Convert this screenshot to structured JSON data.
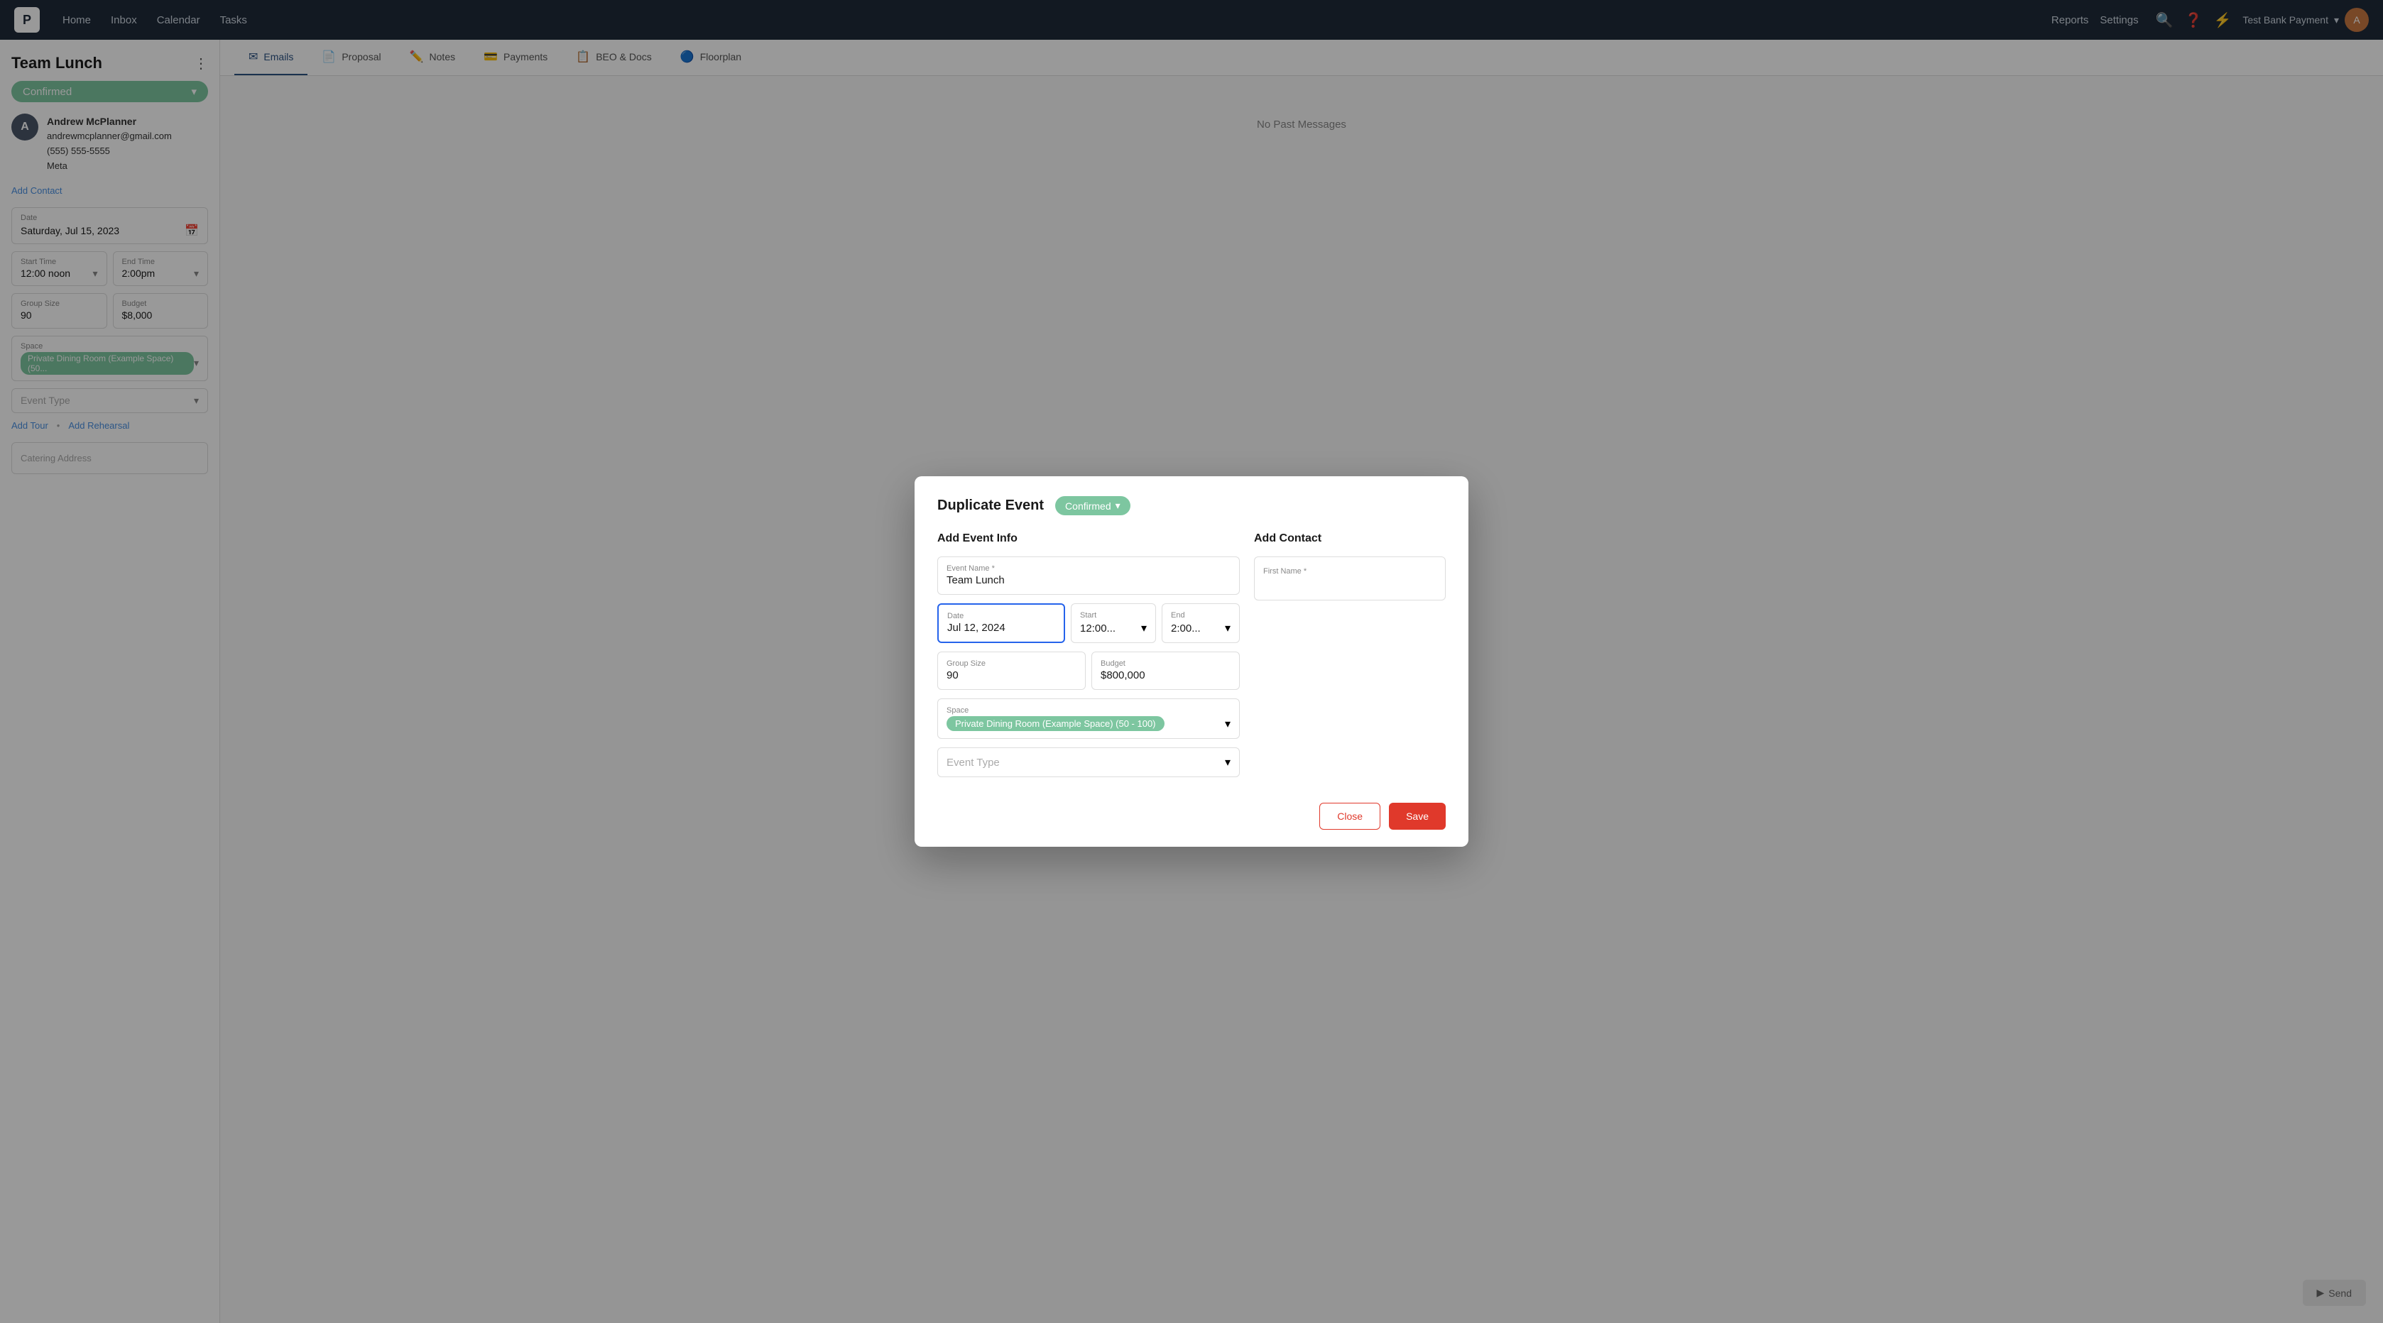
{
  "nav": {
    "logo": "P",
    "links": [
      "Home",
      "Inbox",
      "Calendar",
      "Tasks"
    ],
    "right_links": [
      "Reports",
      "Settings"
    ],
    "account_name": "Test Bank Payment",
    "icons": [
      "search",
      "help",
      "lightning"
    ]
  },
  "sidebar": {
    "title": "Team Lunch",
    "status": "Confirmed",
    "contact": {
      "initial": "A",
      "name": "Andrew McPlanner",
      "email": "andrewmcplanner@gmail.com",
      "phone": "(555) 555-5555",
      "company": "Meta"
    },
    "add_contact": "Add Contact",
    "date_label": "Date",
    "date_value": "Saturday, Jul 15, 2023",
    "start_time_label": "Start Time",
    "start_time_value": "12:00 noon",
    "end_time_label": "End Time",
    "end_time_value": "2:00pm",
    "group_size_label": "Group Size",
    "group_size_value": "90",
    "budget_label": "Budget",
    "budget_value": "$8,000",
    "space_label": "Space",
    "space_value": "Private Dining Room (Example Space) (50...",
    "event_type_label": "Event Type",
    "event_type_placeholder": "Event Type",
    "add_tour": "Add Tour",
    "add_rehearsal": "Add Rehearsal",
    "catering_address": "Catering Address"
  },
  "tabs": [
    {
      "label": "Emails",
      "icon": "✉",
      "active": true
    },
    {
      "label": "Proposal",
      "icon": "📄",
      "active": false
    },
    {
      "label": "Notes",
      "icon": "✏",
      "active": false
    },
    {
      "label": "Payments",
      "icon": "💳",
      "active": false
    },
    {
      "label": "BEO & Docs",
      "icon": "📋",
      "active": false
    },
    {
      "label": "Floorplan",
      "icon": "🔵",
      "active": false
    }
  ],
  "content": {
    "no_messages": "No Past Messages",
    "send_label": "Send"
  },
  "modal": {
    "title": "Duplicate Event",
    "status": "Confirmed",
    "add_event_info": "Add Event Info",
    "event_name_label": "Event Name *",
    "event_name_value": "Team Lunch",
    "date_label": "Date",
    "date_value": "Jul 12, 2024",
    "start_label": "Start",
    "start_value": "12:00...",
    "end_label": "End",
    "end_value": "2:00...",
    "group_size_label": "Group Size",
    "group_size_value": "90",
    "budget_label": "Budget",
    "budget_value": "$800,000",
    "space_label": "Space",
    "space_value": "Private Dining Room (Example Space) (50 - 100)",
    "event_type_label": "Event Type",
    "event_type_placeholder": "Event Type",
    "add_contact": "Add Contact",
    "first_name_label": "First Name *",
    "close_label": "Close",
    "save_label": "Save"
  }
}
